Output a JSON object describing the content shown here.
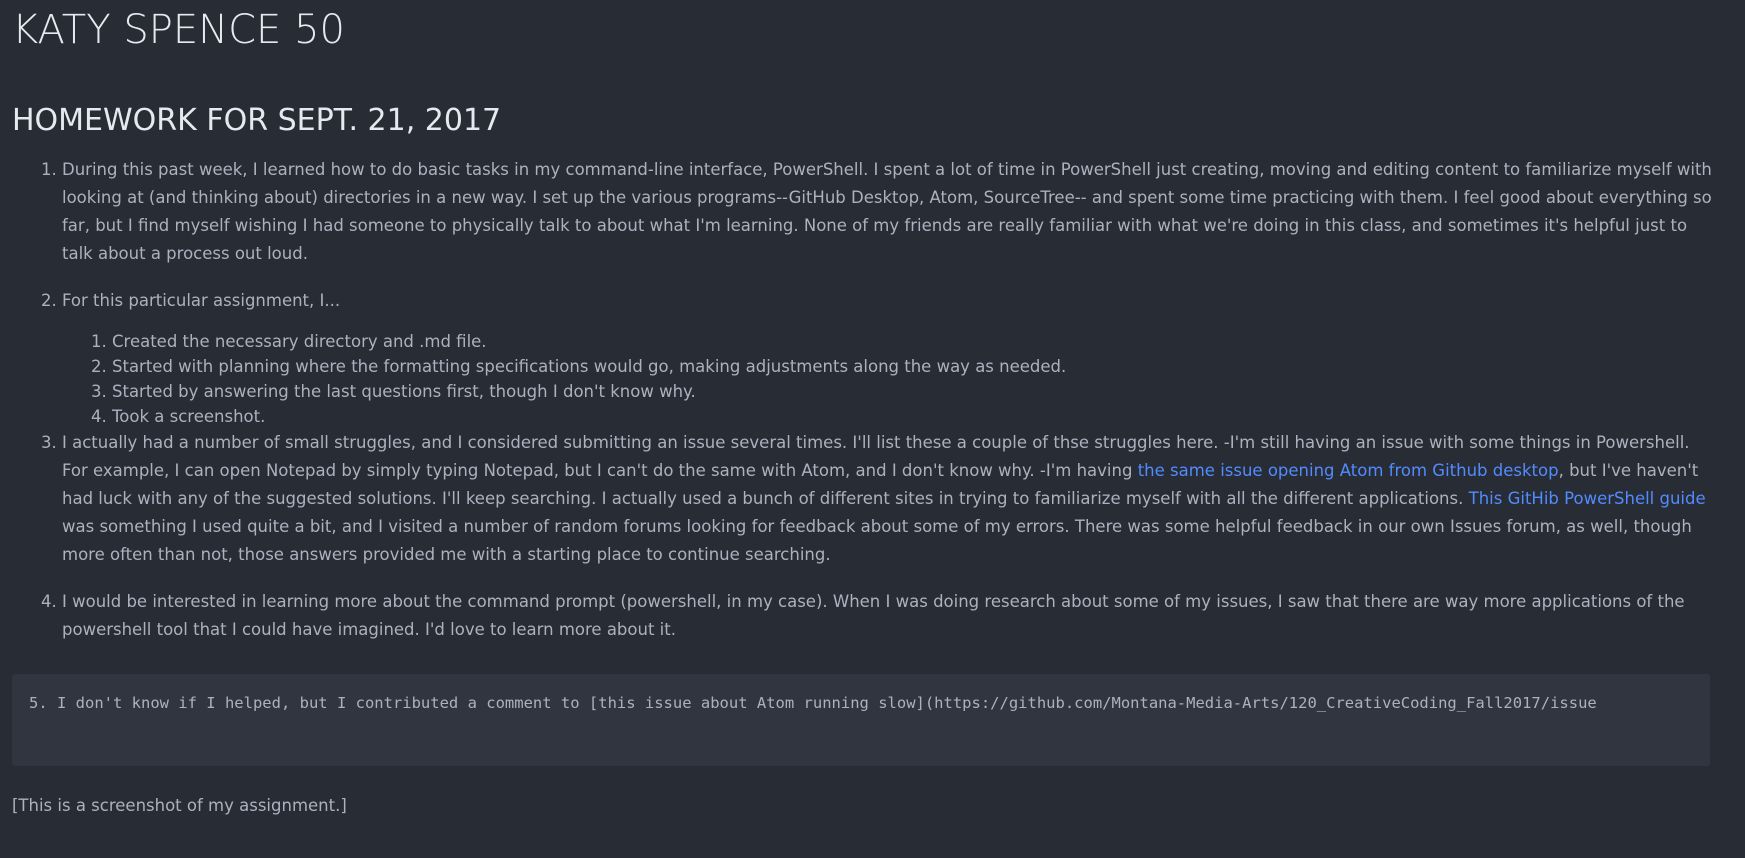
{
  "title": "KATY SPENCE 50",
  "subtitle": "HOMEWORK FOR SEPT. 21, 2017",
  "items": [
    {
      "text": "During this past week, I learned how to do basic tasks in my command-line interface, PowerShell. I spent a lot of time in PowerShell just creating, moving and editing content to familiarize myself with looking at (and thinking about) directories in a new way. I set up the various programs--GitHub Desktop, Atom, SourceTree-- and spent some time practicing with them. I feel good about everything so far, but I find myself wishing I had someone to physically talk to about what I'm learning. None of my friends are really familiar with what we're doing in this class, and sometimes it's helpful just to talk about a process out loud."
    },
    {
      "text": "For this particular assignment, I...",
      "subitems": [
        "Created the necessary directory and .md file.",
        "Started with planning where the formatting specifications would go, making adjustments along the way as needed.",
        "Started by answering the last questions first, though I don't know why.",
        "Took a screenshot."
      ]
    },
    {
      "text_a": "I actually had a number of small struggles, and I considered submitting an issue several times. I'll list these a couple of thse struggles here. -I'm still having an issue with some things in Powershell. For example, I can open Notepad by simply typing Notepad, but I can't do the same with Atom, and I don't know why. -I'm having ",
      "link_1": "the same issue opening Atom from Github desktop",
      "text_b": ", but I've haven't had luck with any of the suggested solutions. I'll keep searching. I actually used a bunch of different sites in trying to familiarize myself with all the different applications. ",
      "link_2": "This GitHib PowerShell guide",
      "text_c": " was something I used quite a bit, and I visited a number of random forums looking for feedback about some of my errors. There was some helpful feedback in our own Issues forum, as well, though more often than not, those answers provided me with a starting place to continue searching."
    },
    {
      "text": "I would be interested in learning more about the command prompt (powershell, in my case). When I was doing research about some of my issues, I saw that there are way more applications of the powershell tool that I could have imagined. I'd love to learn more about it."
    }
  ],
  "code_block": "5. I don't know if I helped, but I contributed a comment to [this issue about Atom running slow](https://github.com/Montana-Media-Arts/120_CreativeCoding_Fall2017/issue",
  "caption": "[This is a screenshot of my assignment.]",
  "colors": {
    "background": "#282c34",
    "text": "#abb2bf",
    "heading": "#e6e9ef",
    "link": "#528bff",
    "code_background": "#31353f"
  }
}
